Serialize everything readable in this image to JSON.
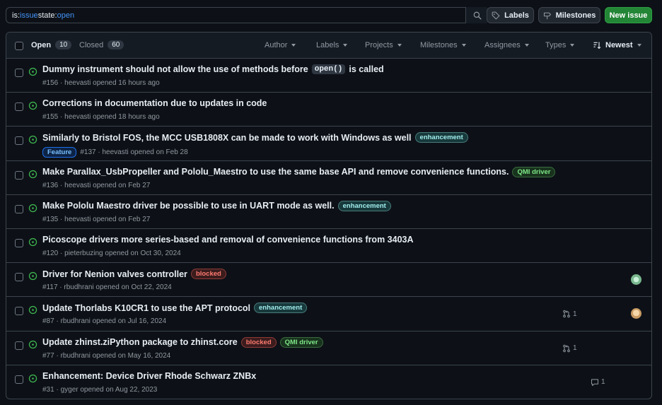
{
  "search": {
    "query": [
      {
        "key": "is:",
        "value": "issue"
      },
      {
        "key": " state:",
        "value": "open"
      }
    ]
  },
  "toolbar": {
    "labels_button": "Labels",
    "milestones_button": "Milestones",
    "new_issue_button": "New issue"
  },
  "header": {
    "open_label": "Open",
    "open_count": "10",
    "closed_label": "Closed",
    "closed_count": "60",
    "filters": {
      "author": "Author",
      "labels": "Labels",
      "projects": "Projects",
      "milestones": "Milestones",
      "assignees": "Assignees",
      "types": "Types",
      "sort": "Newest"
    }
  },
  "colors": {
    "open_status": "#3fb950",
    "accent_blue": "#4493f8",
    "new_issue_green": "#238636"
  },
  "issues": [
    {
      "title_before": "Dummy instrument should not allow the use of methods before",
      "title_code": "open()",
      "title_after": "is called",
      "meta": "#156 · heevasti opened 16 hours ago",
      "labels": []
    },
    {
      "title": "Corrections in documentation due to updates in code",
      "meta": "#155 · heevasti opened 18 hours ago",
      "labels": []
    },
    {
      "title": "Similarly to Bristol FOS, the MCC USB1808X can be made to work with Windows as well",
      "labels": [
        {
          "text": "enhancement",
          "kind": "enhancement"
        }
      ],
      "type_label": "Feature",
      "meta": "#137 · heevasti opened on Feb 28"
    },
    {
      "title": "Make Parallax_UsbPropeller and Pololu_Maestro to use the same base API and remove convenience functions.",
      "labels": [
        {
          "text": "QMI driver",
          "kind": "qmi"
        }
      ],
      "meta": "#136 · heevasti opened on Feb 27"
    },
    {
      "title": "Make Pololu Maestro driver be possible to use in UART mode as well.",
      "labels": [
        {
          "text": "enhancement",
          "kind": "enhancement"
        }
      ],
      "meta": "#135 · heevasti opened on Feb 27"
    },
    {
      "title": "Picoscope drivers more series-based and removal of convenience functions from 3403A",
      "labels": [],
      "meta": "#120 · pieterbuzing opened on Oct 30, 2024"
    },
    {
      "title": "Driver for Nenion valves controller",
      "labels": [
        {
          "text": "blocked",
          "kind": "blocked"
        }
      ],
      "meta": "#117 · rbudhrani opened on Oct 22, 2024",
      "avatar": true
    },
    {
      "title": "Update Thorlabs K10CR1 to use the APT protocol",
      "labels": [
        {
          "text": "enhancement",
          "kind": "enhancement"
        }
      ],
      "meta": "#87 · rbudhrani opened on Jul 16, 2024",
      "linked_prs": "1",
      "avatar": true
    },
    {
      "title": "Update zhinst.ziPython package to zhinst.core",
      "labels": [
        {
          "text": "blocked",
          "kind": "blocked"
        },
        {
          "text": "QMI driver",
          "kind": "qmi"
        }
      ],
      "meta": "#77 · rbudhrani opened on May 16, 2024",
      "linked_prs": "1"
    },
    {
      "title": "Enhancement: Device Driver Rhode Schwarz ZNBx",
      "labels": [],
      "meta": "#31 · gyger opened on Aug 22, 2023",
      "comments": "1"
    }
  ]
}
